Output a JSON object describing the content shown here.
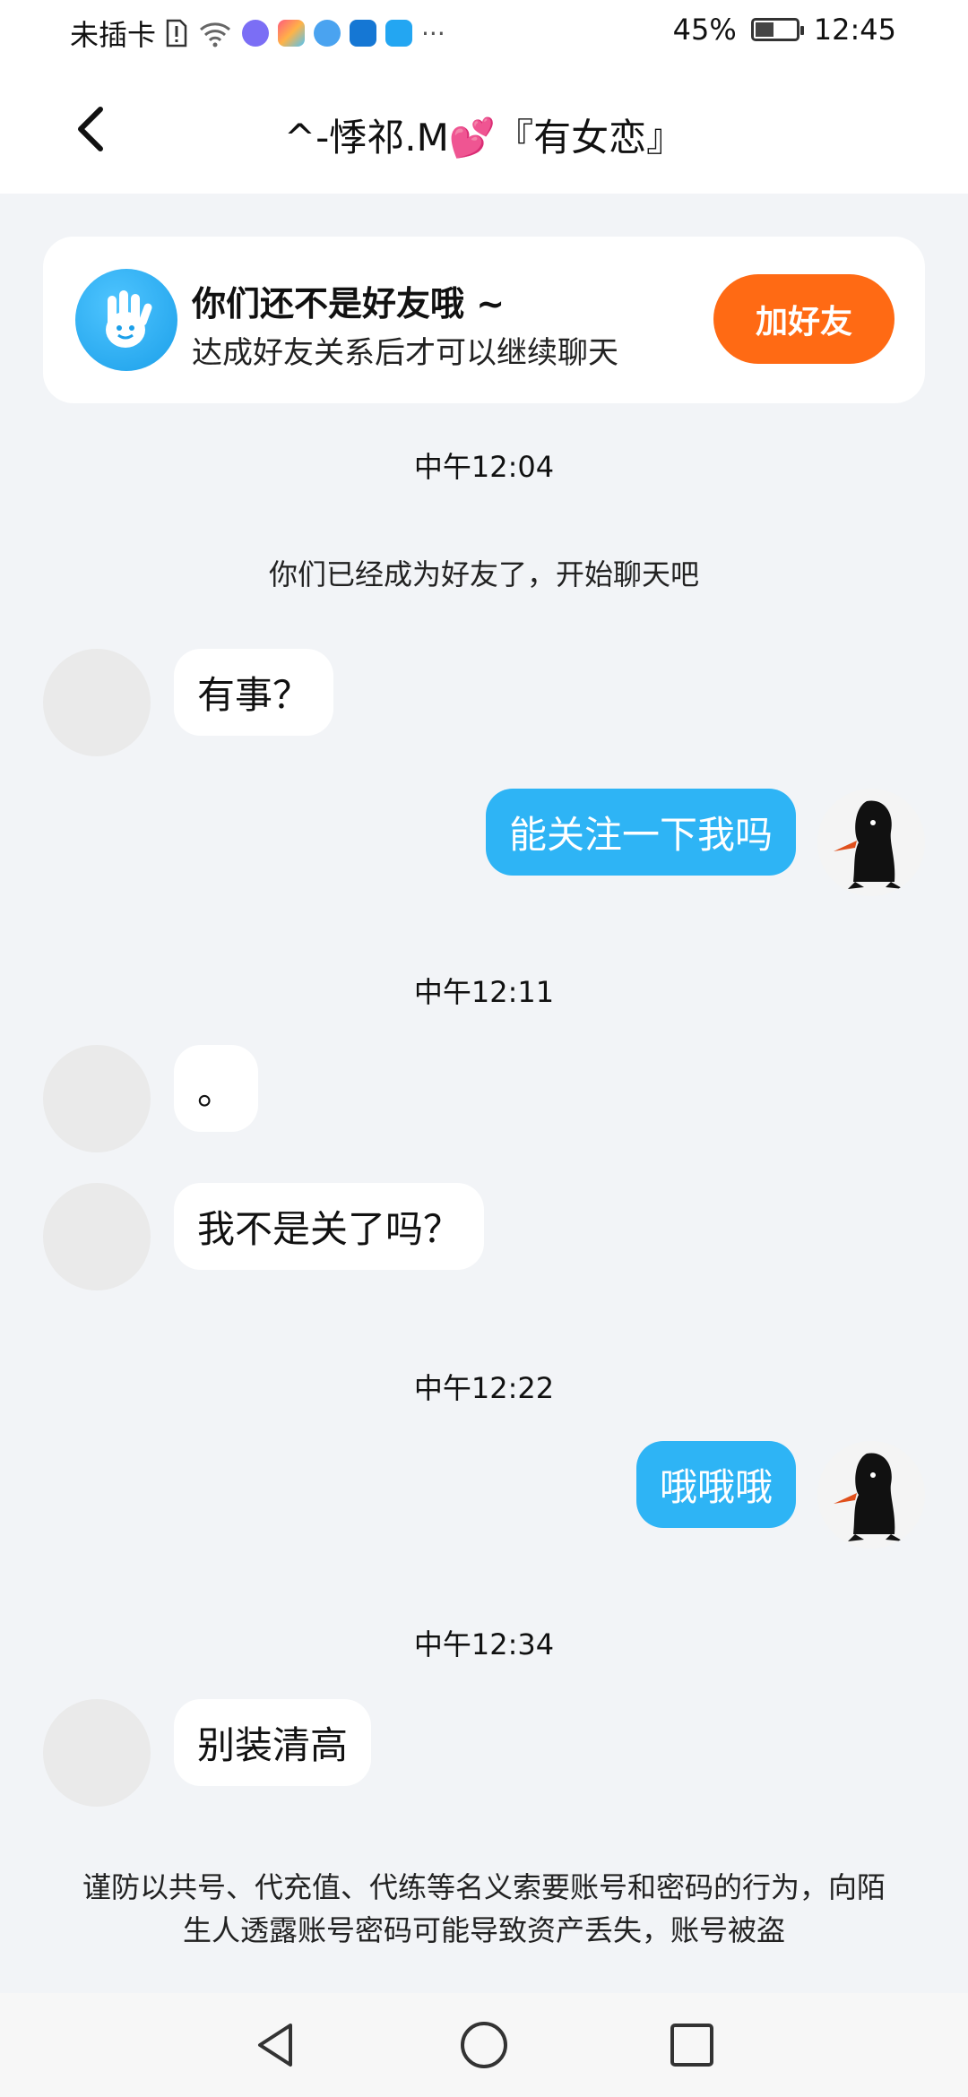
{
  "status_bar": {
    "carrier": "未插卡",
    "battery": "45%",
    "battery_level": 0.45,
    "time": "12:45",
    "more": "···"
  },
  "header": {
    "title": "^-悸祁.M💕『有女恋』",
    "back_icon": "chevron-left-icon"
  },
  "banner": {
    "title": "你们还不是好友哦 ~",
    "subtitle": "达成好友关系后才可以继续聊天",
    "button": "加好友",
    "accent": "#ff6a14",
    "icon": "waving-hand-icon"
  },
  "messages": [
    {
      "type": "time",
      "text": "中午12:04"
    },
    {
      "type": "system",
      "text": "你们已经成为好友了，开始聊天吧"
    },
    {
      "type": "in",
      "text": "有事？"
    },
    {
      "type": "out",
      "text": "能关注一下我吗"
    },
    {
      "type": "time",
      "text": "中午12:11"
    },
    {
      "type": "in",
      "text": "。"
    },
    {
      "type": "in",
      "text": "我不是关了吗？"
    },
    {
      "type": "time",
      "text": "中午12:22"
    },
    {
      "type": "out",
      "text": "哦哦哦"
    },
    {
      "type": "time",
      "text": "中午12:34"
    },
    {
      "type": "in",
      "text": "别装清高"
    }
  ],
  "warning": "谨防以共号、代充值、代练等名义索要账号和密码的行为，向陌生人透露账号密码可能导致资产丢失，账号被盗",
  "colors": {
    "outgoing_bubble": "#2eb4f5",
    "background": "#f2f4f7"
  }
}
